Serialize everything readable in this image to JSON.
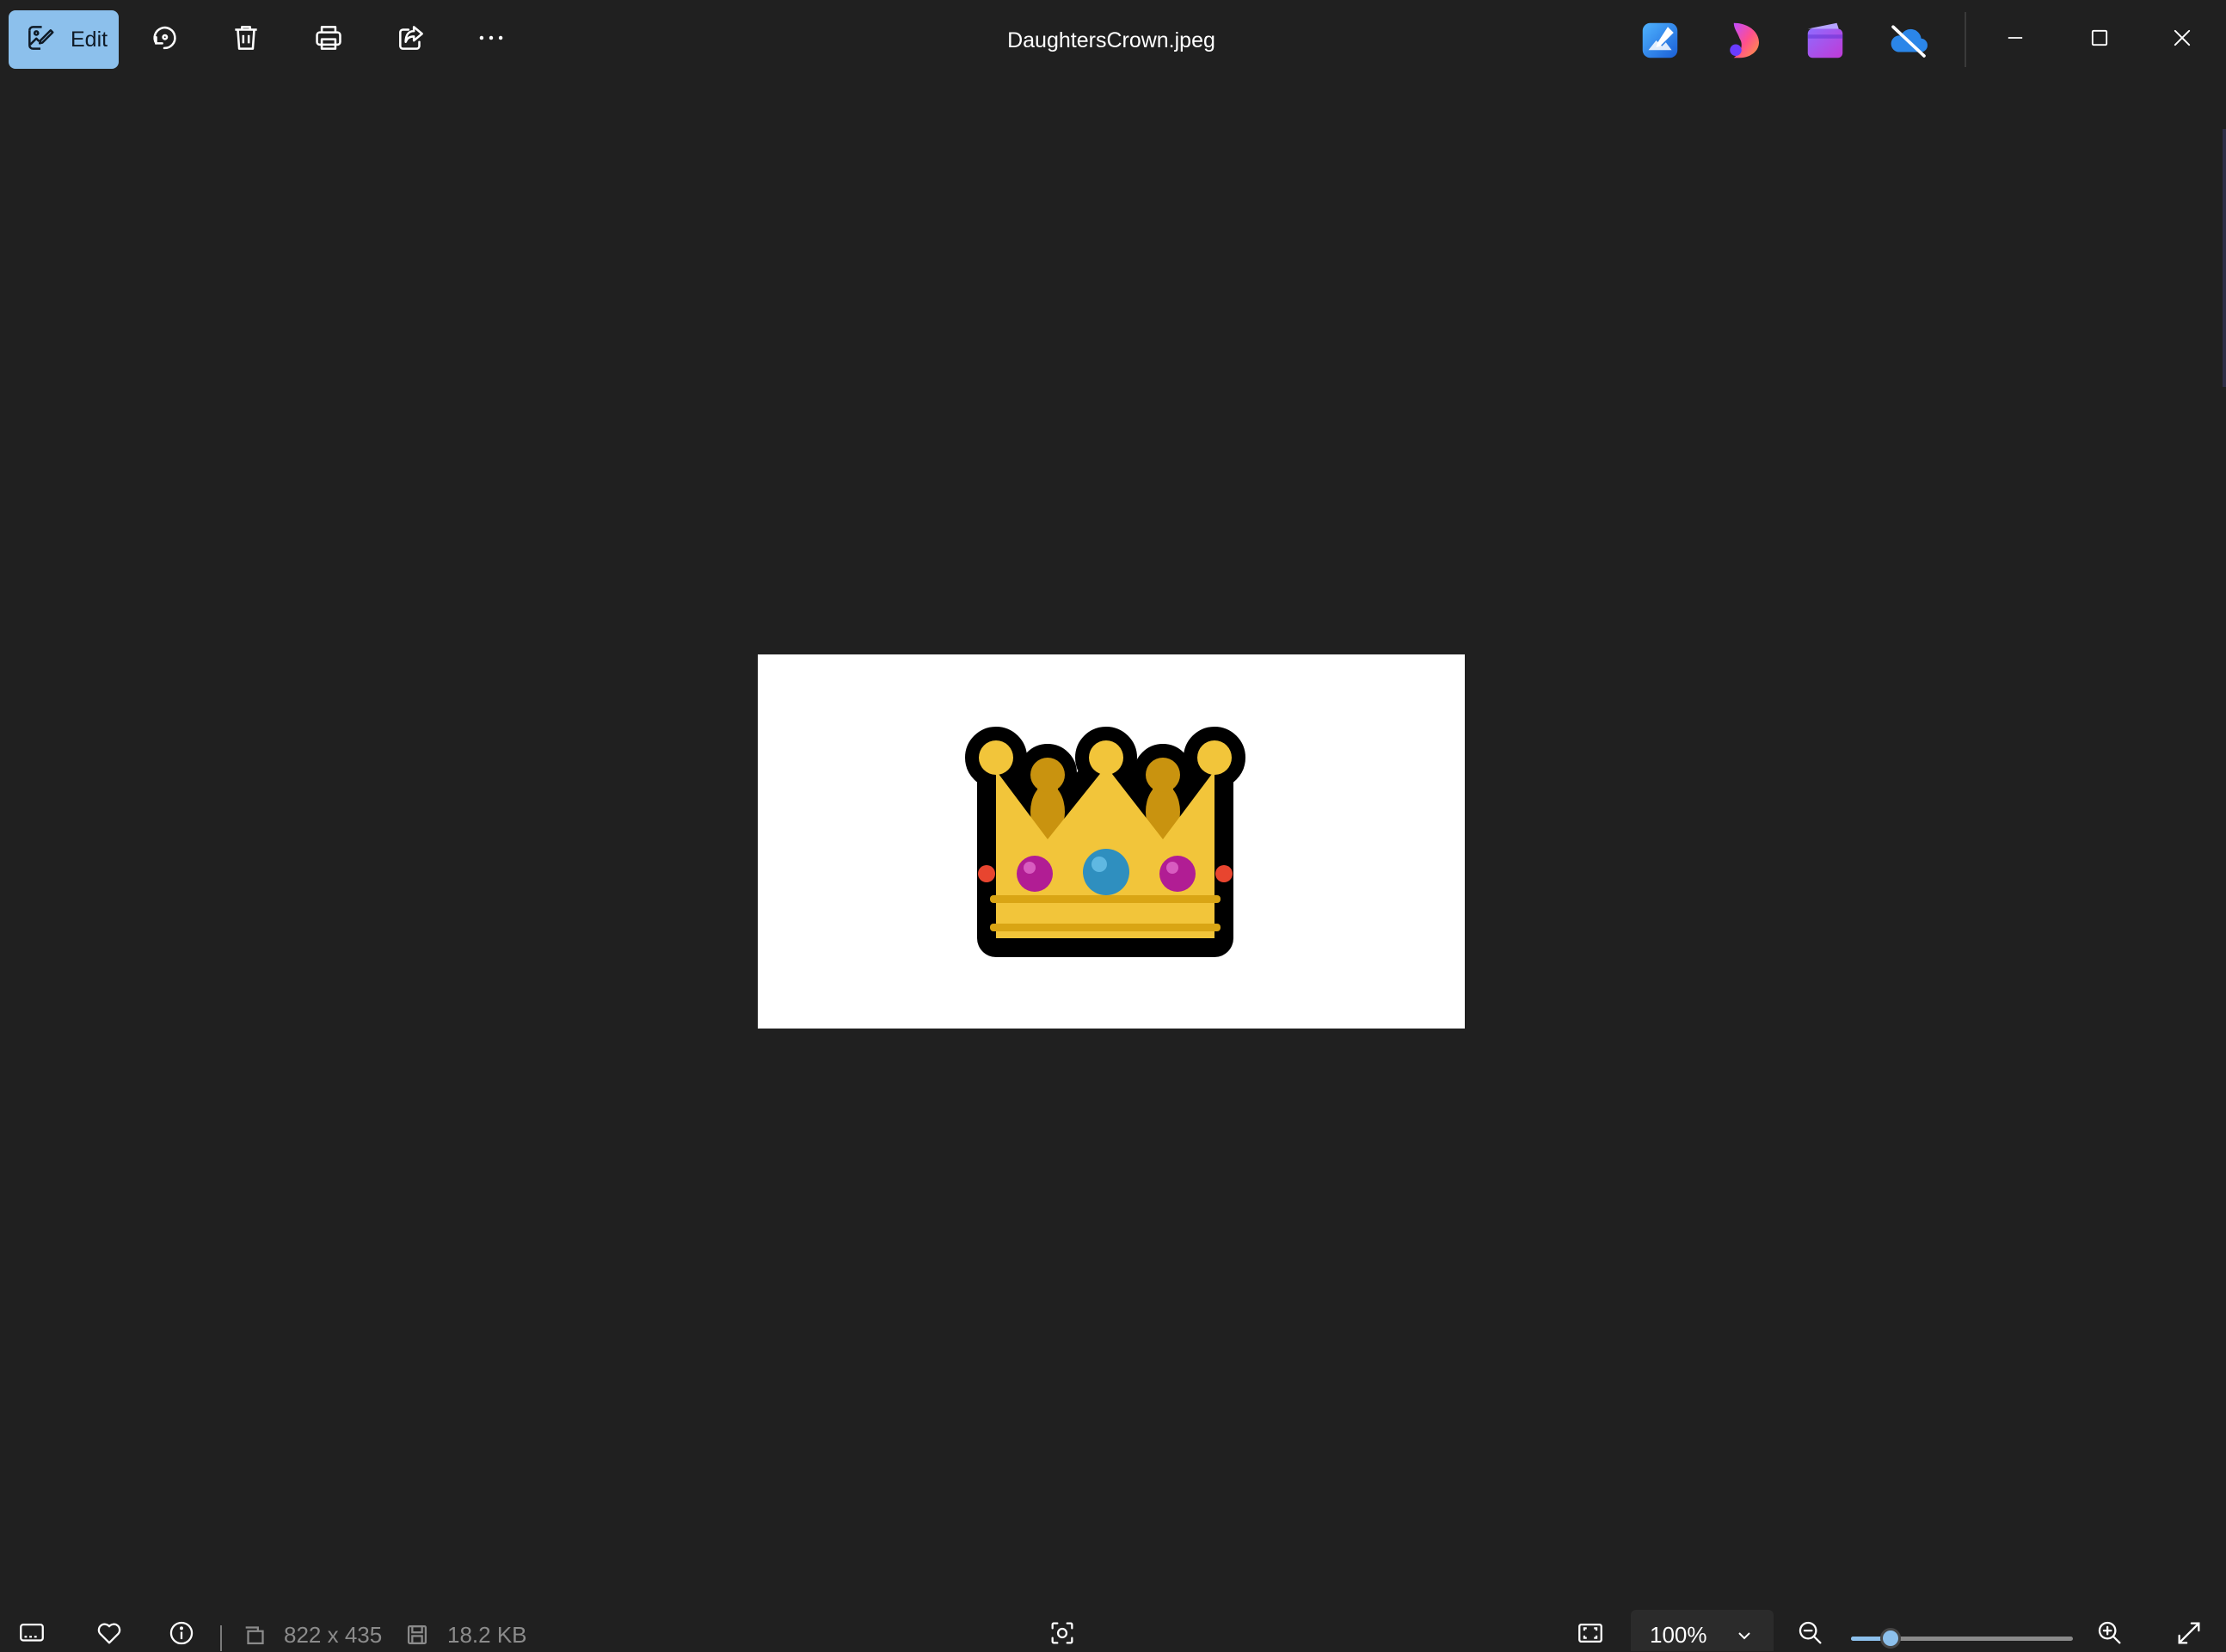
{
  "toolbar": {
    "edit_label": "Edit",
    "buttons": [
      "rotate-icon",
      "delete-icon",
      "print-icon",
      "share-icon",
      "more-options-icon"
    ]
  },
  "window": {
    "title": "DaughtersCrown.jpeg",
    "app_icons": [
      "photos-editor-icon",
      "clipchamp-icon",
      "video-editor-icon",
      "onedrive-off-icon"
    ],
    "controls": [
      "minimize-icon",
      "maximize-icon",
      "close-icon"
    ]
  },
  "image": {
    "description_icon": "crown-emoji",
    "background_color": "#ffffff"
  },
  "statusbar": {
    "dimensions": "822 x 435",
    "file_size": "18.2 KB",
    "zoom": "100%",
    "zoom_slider_level": 0.18
  },
  "colors": {
    "background": "#202020",
    "accent": "#8cc0ec",
    "dim_text": "#8b8b8b"
  }
}
